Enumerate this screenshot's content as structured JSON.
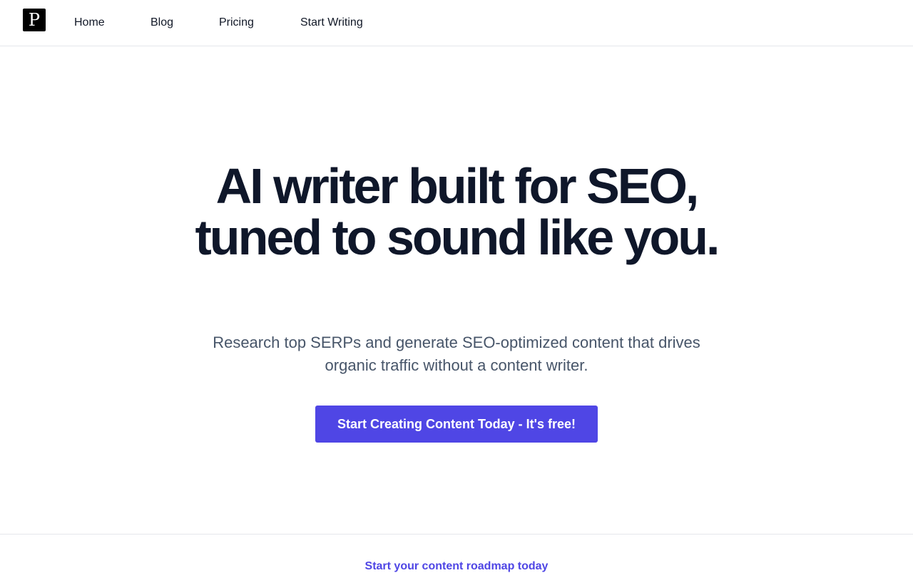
{
  "logo": {
    "letter": "P"
  },
  "nav": {
    "items": [
      {
        "label": "Home"
      },
      {
        "label": "Blog"
      },
      {
        "label": "Pricing"
      },
      {
        "label": "Start Writing"
      }
    ]
  },
  "hero": {
    "headline": "AI writer built for SEO, tuned to sound like you.",
    "subheadline": "Research top SERPs and generate SEO-optimized content that drives organic traffic without a content writer.",
    "cta_label": "Start Creating Content Today - It's free!"
  },
  "section": {
    "eyebrow": "Start your content roadmap today"
  },
  "colors": {
    "accent": "#4f46e5",
    "headline": "#0f172a",
    "body": "#475569"
  }
}
